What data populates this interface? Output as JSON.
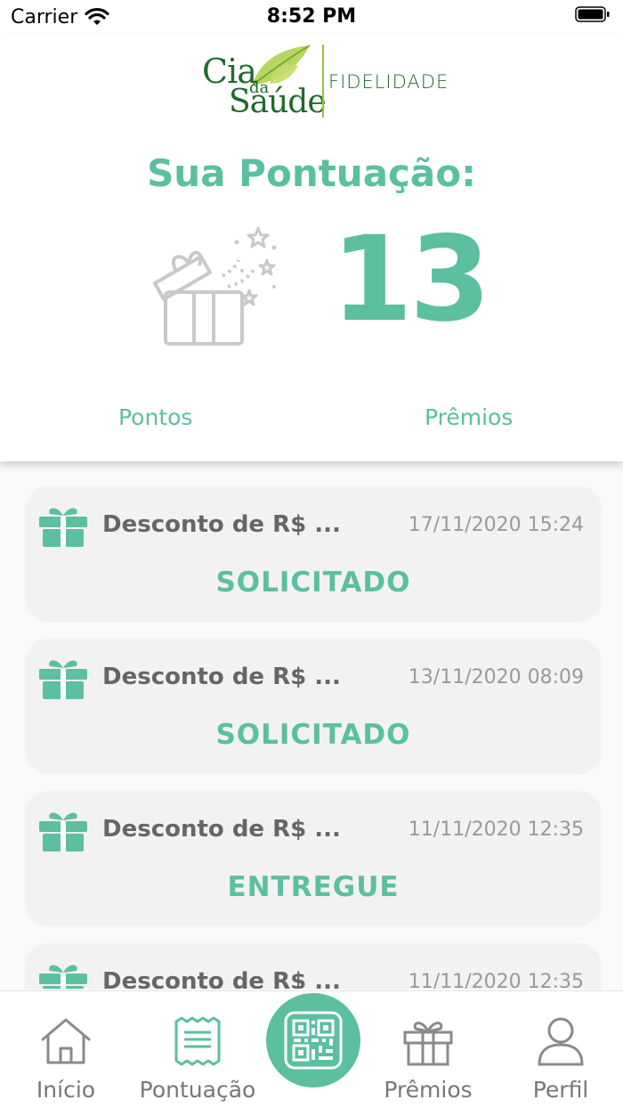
{
  "status_bar": {
    "carrier": "Carrier",
    "time": "8:52 PM"
  },
  "logo": {
    "line1": "Cia",
    "line2": "da",
    "line3": "Saúde",
    "subtitle": "FIDELIDADE"
  },
  "score": {
    "title": "Sua Pontuação:",
    "value": "13"
  },
  "tabs": [
    {
      "label": "Pontos"
    },
    {
      "label": "Prêmios"
    }
  ],
  "rewards": [
    {
      "title": "Desconto de R$ ...",
      "date": "17/11/2020 15:24",
      "status": "SOLICITADO"
    },
    {
      "title": "Desconto de R$ ...",
      "date": "13/11/2020 08:09",
      "status": "SOLICITADO"
    },
    {
      "title": "Desconto de R$ ...",
      "date": "11/11/2020 12:35",
      "status": "ENTREGUE"
    },
    {
      "title": "Desconto de R$ ...",
      "date": "11/11/2020 12:35",
      "status": ""
    }
  ],
  "nav": [
    {
      "label": "Início",
      "icon": "home-icon"
    },
    {
      "label": "Pontuação",
      "icon": "receipt-icon"
    },
    {
      "label": "",
      "icon": "qr-code-icon"
    },
    {
      "label": "Prêmios",
      "icon": "gift-icon"
    },
    {
      "label": "Perfil",
      "icon": "user-icon"
    }
  ],
  "colors": {
    "accent": "#5bbfa0",
    "brand_green": "#1e6b2e",
    "card_bg": "#f2f2f2"
  }
}
